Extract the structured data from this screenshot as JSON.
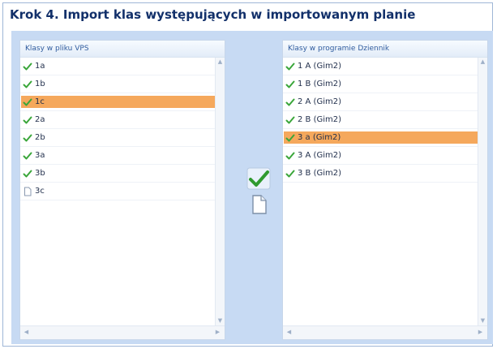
{
  "title": "Krok 4. Import klas występujących w importowanym planie",
  "left_panel": {
    "header": "Klasy w pliku VPS",
    "items": [
      {
        "label": "1a",
        "status": "checked",
        "selected": false
      },
      {
        "label": "1b",
        "status": "checked",
        "selected": false
      },
      {
        "label": "1c",
        "status": "checked",
        "selected": true
      },
      {
        "label": "2a",
        "status": "checked",
        "selected": false
      },
      {
        "label": "2b",
        "status": "checked",
        "selected": false
      },
      {
        "label": "3a",
        "status": "checked",
        "selected": false
      },
      {
        "label": "3b",
        "status": "checked",
        "selected": false
      },
      {
        "label": "3c",
        "status": "empty",
        "selected": false
      }
    ]
  },
  "right_panel": {
    "header": "Klasy w programie Dziennik",
    "items": [
      {
        "label": "1 A (Gim2)",
        "status": "checked",
        "selected": false
      },
      {
        "label": "1 B (Gim2)",
        "status": "checked",
        "selected": false
      },
      {
        "label": "2 A (Gim2)",
        "status": "checked",
        "selected": false
      },
      {
        "label": "2 B (Gim2)",
        "status": "checked",
        "selected": false
      },
      {
        "label": "3 a (Gim2)",
        "status": "checked",
        "selected": true
      },
      {
        "label": "3 A (Gim2)",
        "status": "checked",
        "selected": false
      },
      {
        "label": "3 B (Gim2)",
        "status": "checked",
        "selected": false
      }
    ]
  },
  "actions": {
    "assign_icon": "check-mark-icon",
    "new_icon": "new-document-icon"
  },
  "colors": {
    "title": "#12306a",
    "background": "#c7daf3",
    "selection": "#f5a85c",
    "check": "#3aa63a"
  }
}
